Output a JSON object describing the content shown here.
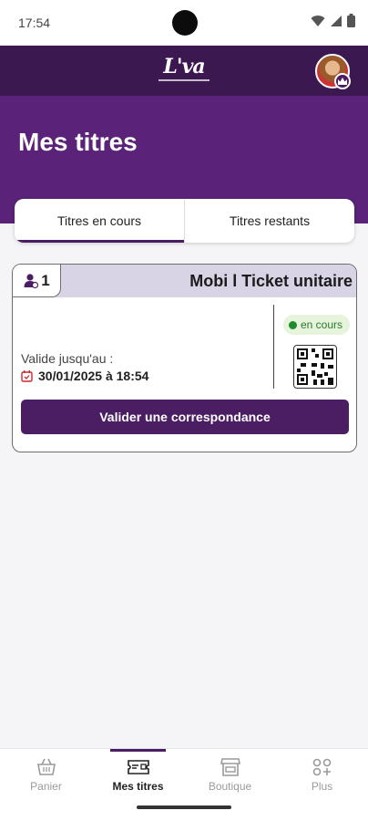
{
  "status_bar": {
    "time": "17:54"
  },
  "header": {
    "logo_text": "L'va"
  },
  "page": {
    "title": "Mes titres"
  },
  "tabs": [
    {
      "label": "Titres en cours",
      "active": true
    },
    {
      "label": "Titres restants",
      "active": false
    }
  ],
  "ticket": {
    "passenger_count": "1",
    "name": "Mobi l Ticket unitaire",
    "status": "en cours",
    "valid_label": "Valide jusqu'au :",
    "valid_until": "30/01/2025 à 18:54",
    "action_label": "Valider une correspondance"
  },
  "bottom_nav": [
    {
      "label": "Panier",
      "icon": "basket-icon",
      "active": false
    },
    {
      "label": "Mes titres",
      "icon": "ticket-icon",
      "active": true
    },
    {
      "label": "Boutique",
      "icon": "shop-icon",
      "active": false
    },
    {
      "label": "Plus",
      "icon": "grid-plus-icon",
      "active": false
    }
  ],
  "colors": {
    "brand_dark": "#3c1850",
    "brand": "#5a2278",
    "button": "#4b1d63",
    "status_green": "#1e8c2a"
  }
}
